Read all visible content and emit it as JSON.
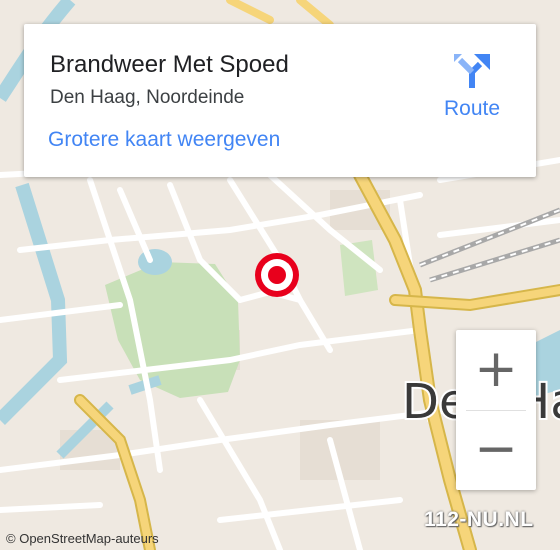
{
  "card": {
    "title": "Brandweer Met Spoed",
    "address": "Den Haag, Noordeinde",
    "link": "Grotere kaart weergeven",
    "route_label": "Route"
  },
  "map": {
    "city_label": "Den Haag",
    "attribution": "OpenStreetMap-auteurs",
    "attribution_symbol": "©",
    "watermark": "112-NU.NL",
    "colors": {
      "land": "#efe9e1",
      "water": "#aad3df",
      "park": "#c8e0b8",
      "major_road": "#f6d57a",
      "minor_road": "#ffffff",
      "marker": "#e8001c",
      "accent": "#4285f4"
    }
  },
  "zoom": {
    "in_label": "+",
    "out_label": "−"
  }
}
